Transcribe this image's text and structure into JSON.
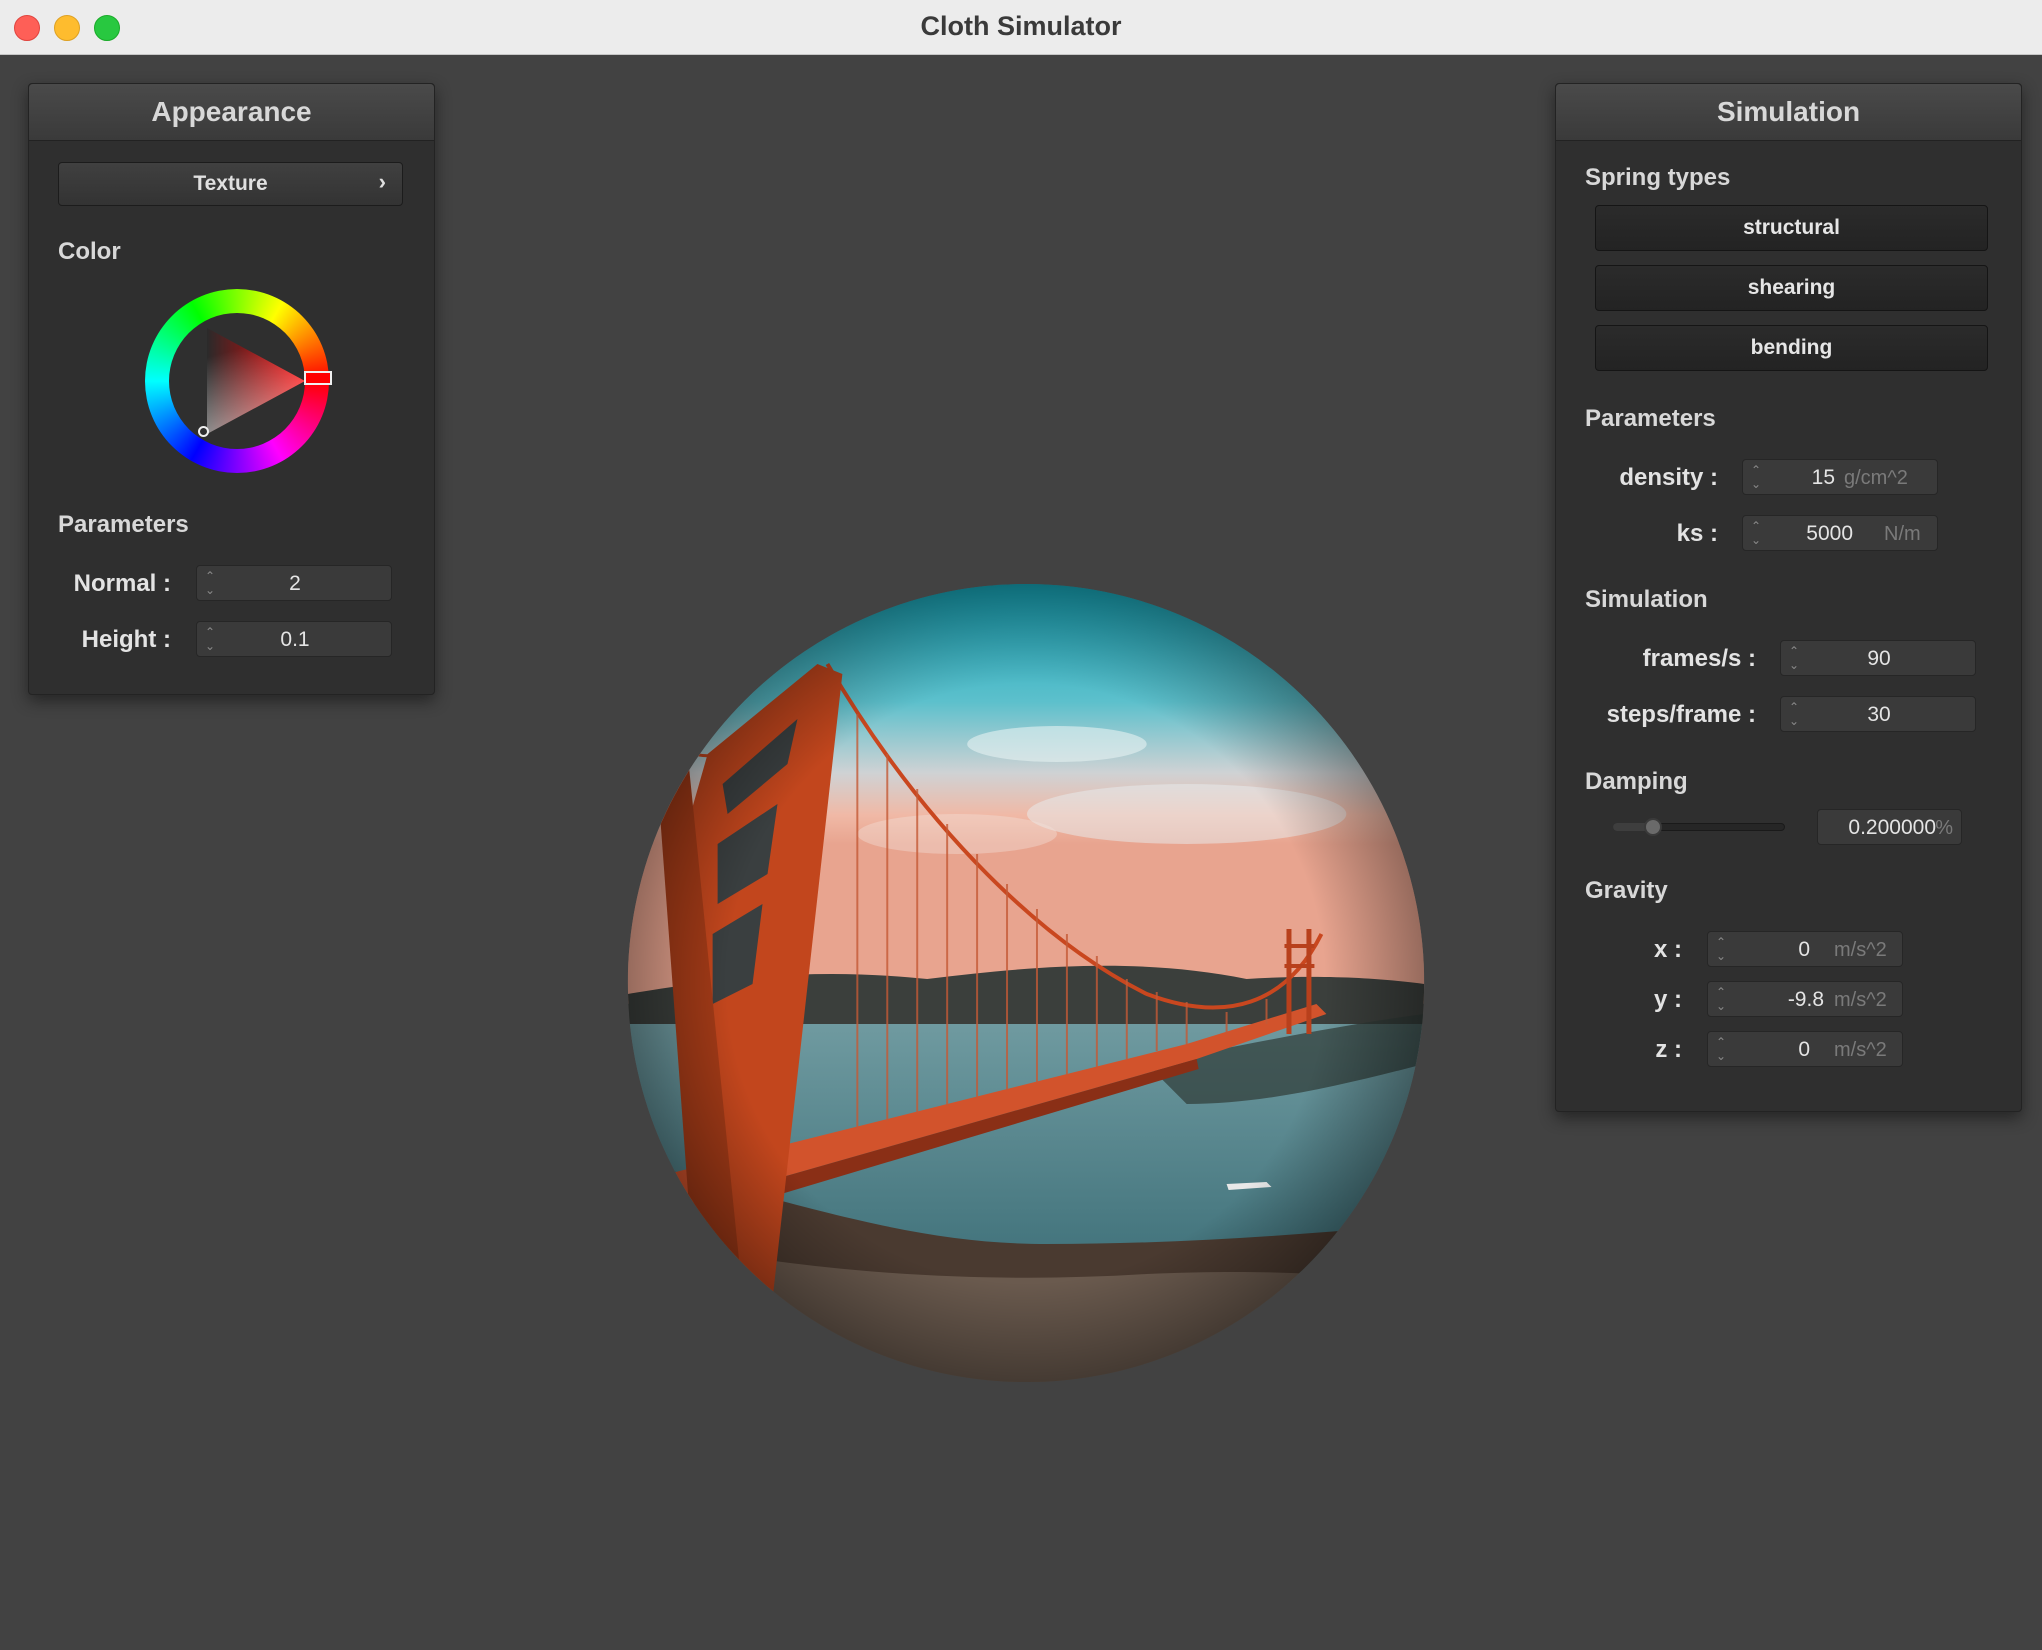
{
  "window": {
    "title": "Cloth Simulator"
  },
  "appearance": {
    "header": "Appearance",
    "texture_button": "Texture",
    "texture_chevron": "›",
    "color_label": "Color",
    "color_value": "#ff0000",
    "parameters_label": "Parameters",
    "normal": {
      "label": "Normal :",
      "value": "2"
    },
    "height": {
      "label": "Height :",
      "value": "0.1"
    }
  },
  "simulation": {
    "header": "Simulation",
    "spring_types_label": "Spring types",
    "spring_types": [
      "structural",
      "shearing",
      "bending"
    ],
    "parameters_label": "Parameters",
    "density": {
      "label": "density :",
      "value": "15",
      "unit": "g/cm^2"
    },
    "ks": {
      "label": "ks :",
      "value": "5000",
      "unit": "N/m"
    },
    "simulation_label": "Simulation",
    "frames": {
      "label": "frames/s :",
      "value": "90"
    },
    "steps": {
      "label": "steps/frame :",
      "value": "30"
    },
    "damping_label": "Damping",
    "damping": {
      "value": "0.200000",
      "unit": "%",
      "slider_fraction": 0.2
    },
    "gravity_label": "Gravity",
    "gravity": {
      "x": {
        "label": "x :",
        "value": "0",
        "unit": "m/s^2"
      },
      "y": {
        "label": "y :",
        "value": "-9.8",
        "unit": "m/s^2"
      },
      "z": {
        "label": "z :",
        "value": "0",
        "unit": "m/s^2"
      }
    }
  },
  "viewport": {
    "content": "textured sphere showing a suspension bridge over water at sunset"
  }
}
